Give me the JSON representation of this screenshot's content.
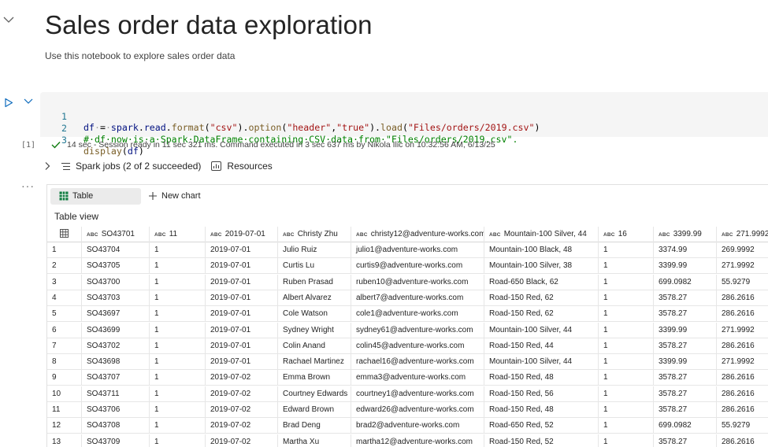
{
  "header": {
    "title": "Sales order data exploration",
    "subtitle": "Use this notebook to explore sales order data"
  },
  "cell": {
    "execution_count": "[1]",
    "code_lines": [
      {
        "n": "1",
        "tokens": [
          {
            "t": "df",
            "c": "var"
          },
          {
            "t": "·",
            "c": "dot"
          },
          {
            "t": "=",
            "c": "op"
          },
          {
            "t": "·",
            "c": "dot"
          },
          {
            "t": "spark",
            "c": "var"
          },
          {
            "t": ".",
            "c": "op"
          },
          {
            "t": "read",
            "c": "var"
          },
          {
            "t": ".",
            "c": "op"
          },
          {
            "t": "format",
            "c": "fn"
          },
          {
            "t": "(",
            "c": "op"
          },
          {
            "t": "\"csv\"",
            "c": "str"
          },
          {
            "t": ").",
            "c": "op"
          },
          {
            "t": "option",
            "c": "fn"
          },
          {
            "t": "(",
            "c": "op"
          },
          {
            "t": "\"header\"",
            "c": "str"
          },
          {
            "t": ",",
            "c": "op"
          },
          {
            "t": "\"true\"",
            "c": "str"
          },
          {
            "t": ").",
            "c": "op"
          },
          {
            "t": "load",
            "c": "fn"
          },
          {
            "t": "(",
            "c": "op"
          },
          {
            "t": "\"Files/orders/2019.csv\"",
            "c": "str"
          },
          {
            "t": ")",
            "c": "op"
          }
        ]
      },
      {
        "n": "2",
        "tokens": [
          {
            "t": "#·df·now·is·a·Spark·DataFrame·containing·CSV·data·from·\"Files/orders/2019.csv\".",
            "c": "cmt"
          }
        ]
      },
      {
        "n": "3",
        "tokens": [
          {
            "t": "display",
            "c": "fn"
          },
          {
            "t": "(",
            "c": "op"
          },
          {
            "t": "df",
            "c": "var"
          },
          {
            "t": ")",
            "c": "op"
          }
        ]
      }
    ],
    "status_text": "14 sec - Session ready in 11 sec 321 ms. Command executed in 3 sec 637 ms by Nikola Ilic on 10:32:56 AM, 6/13/25",
    "jobs_label": "Spark jobs (2 of 2 succeeded)",
    "resources_label": "Resources",
    "more_label": "···"
  },
  "output": {
    "tab_table_label": "Table",
    "new_chart_label": "New chart",
    "table_view_label": "Table view",
    "abc_tag": "ABC",
    "columns": [
      "SO43701",
      "11",
      "2019-07-01",
      "Christy Zhu",
      "christy12@adventure-works.com",
      "Mountain-100 Silver, 44",
      "16",
      "3399.99",
      "271.9992"
    ],
    "rows": [
      [
        "1",
        "SO43704",
        "1",
        "2019-07-01",
        "Julio Ruiz",
        "julio1@adventure-works.com",
        "Mountain-100 Black, 48",
        "1",
        "3374.99",
        "269.9992"
      ],
      [
        "2",
        "SO43705",
        "1",
        "2019-07-01",
        "Curtis Lu",
        "curtis9@adventure-works.com",
        "Mountain-100 Silver, 38",
        "1",
        "3399.99",
        "271.9992"
      ],
      [
        "3",
        "SO43700",
        "1",
        "2019-07-01",
        "Ruben Prasad",
        "ruben10@adventure-works.com",
        "Road-650 Black, 62",
        "1",
        "699.0982",
        "55.9279"
      ],
      [
        "4",
        "SO43703",
        "1",
        "2019-07-01",
        "Albert Alvarez",
        "albert7@adventure-works.com",
        "Road-150 Red, 62",
        "1",
        "3578.27",
        "286.2616"
      ],
      [
        "5",
        "SO43697",
        "1",
        "2019-07-01",
        "Cole Watson",
        "cole1@adventure-works.com",
        "Road-150 Red, 62",
        "1",
        "3578.27",
        "286.2616"
      ],
      [
        "6",
        "SO43699",
        "1",
        "2019-07-01",
        "Sydney Wright",
        "sydney61@adventure-works.com",
        "Mountain-100 Silver, 44",
        "1",
        "3399.99",
        "271.9992"
      ],
      [
        "7",
        "SO43702",
        "1",
        "2019-07-01",
        "Colin Anand",
        "colin45@adventure-works.com",
        "Road-150 Red, 44",
        "1",
        "3578.27",
        "286.2616"
      ],
      [
        "8",
        "SO43698",
        "1",
        "2019-07-01",
        "Rachael Martinez",
        "rachael16@adventure-works.com",
        "Mountain-100 Silver, 44",
        "1",
        "3399.99",
        "271.9992"
      ],
      [
        "9",
        "SO43707",
        "1",
        "2019-07-02",
        "Emma Brown",
        "emma3@adventure-works.com",
        "Road-150 Red, 48",
        "1",
        "3578.27",
        "286.2616"
      ],
      [
        "10",
        "SO43711",
        "1",
        "2019-07-02",
        "Courtney Edwards",
        "courtney1@adventure-works.com",
        "Road-150 Red, 56",
        "1",
        "3578.27",
        "286.2616"
      ],
      [
        "11",
        "SO43706",
        "1",
        "2019-07-02",
        "Edward Brown",
        "edward26@adventure-works.com",
        "Road-150 Red, 48",
        "1",
        "3578.27",
        "286.2616"
      ],
      [
        "12",
        "SO43708",
        "1",
        "2019-07-02",
        "Brad Deng",
        "brad2@adventure-works.com",
        "Road-650 Red, 52",
        "1",
        "699.0982",
        "55.9279"
      ],
      [
        "13",
        "SO43709",
        "1",
        "2019-07-02",
        "Martha Xu",
        "martha12@adventure-works.com",
        "Road-150 Red, 52",
        "1",
        "3578.27",
        "286.2616"
      ]
    ]
  },
  "colors": {
    "accent": "#0f6cbd",
    "success": "#107c10",
    "grid_icon": "#107c41"
  }
}
